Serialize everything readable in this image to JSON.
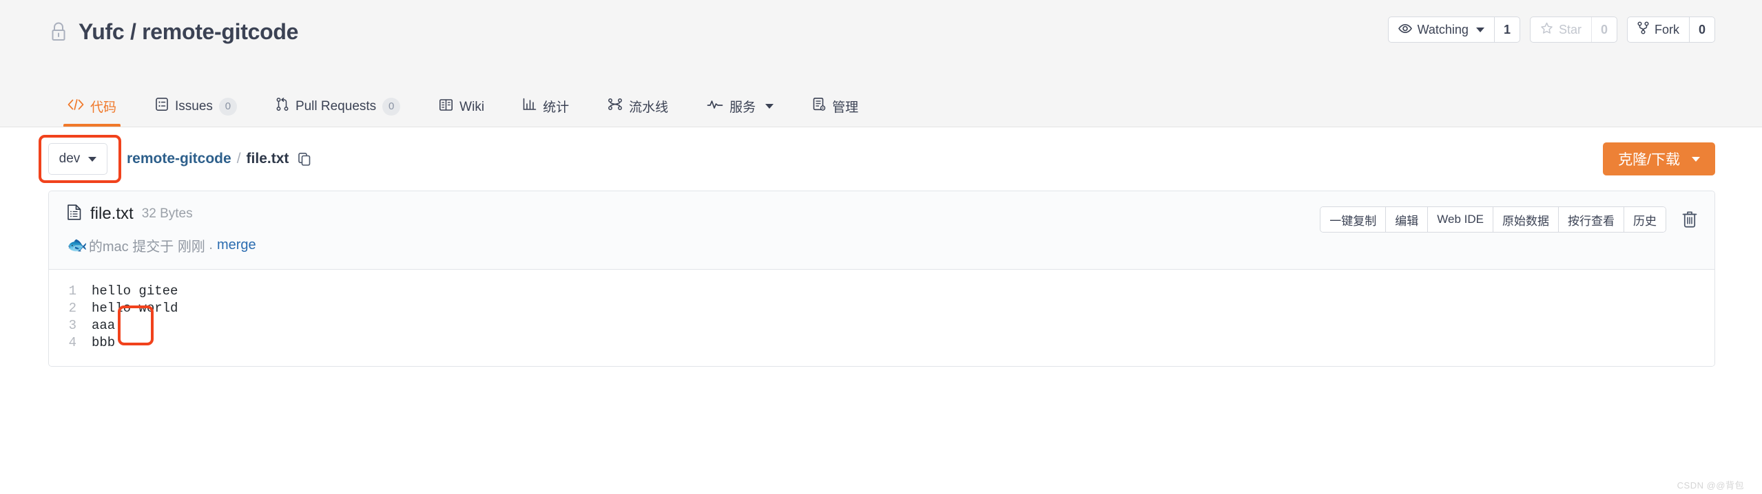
{
  "header": {
    "lock_icon": "lock-icon",
    "title": "Yufc / remote-gitcode",
    "actions": {
      "watch": {
        "icon": "eye-icon",
        "label": "Watching",
        "count": "1"
      },
      "star": {
        "icon": "star-icon",
        "label": "Star",
        "count": "0"
      },
      "fork": {
        "icon": "fork-icon",
        "label": "Fork",
        "count": "0"
      }
    },
    "tabs": [
      {
        "icon": "code-icon",
        "label": "代码",
        "count": null,
        "active": true,
        "has_caret": false
      },
      {
        "icon": "issues-icon",
        "label": "Issues",
        "count": "0",
        "active": false,
        "has_caret": false
      },
      {
        "icon": "pull-request-icon",
        "label": "Pull Requests",
        "count": "0",
        "active": false,
        "has_caret": false
      },
      {
        "icon": "wiki-book-icon",
        "label": "Wiki",
        "count": null,
        "active": false,
        "has_caret": false
      },
      {
        "icon": "stats-chart-icon",
        "label": "统计",
        "count": null,
        "active": false,
        "has_caret": false
      },
      {
        "icon": "pipeline-icon",
        "label": "流水线",
        "count": null,
        "active": false,
        "has_caret": false
      },
      {
        "icon": "service-pulse-icon",
        "label": "服务",
        "count": null,
        "active": false,
        "has_caret": true
      },
      {
        "icon": "manage-doc-icon",
        "label": "管理",
        "count": null,
        "active": false,
        "has_caret": false
      }
    ]
  },
  "toolbar": {
    "branch": {
      "label": "dev",
      "caret_icon": "chevron-down-icon"
    },
    "breadcrumb": {
      "repo": "remote-gitcode",
      "separator": "/",
      "file": "file.txt",
      "copy_icon": "copy-icon"
    },
    "clone_button": {
      "label": "克隆/下载",
      "caret_icon": "chevron-down-icon"
    }
  },
  "file": {
    "icon": "file-text-icon",
    "name": "file.txt",
    "size": "32 Bytes",
    "commit": {
      "avatar_icon": "fish-avatar",
      "author": "的mac",
      "action": "提交于",
      "time": "刚刚",
      "dot": ".",
      "message": "merge"
    },
    "actions": [
      "一键复制",
      "编辑",
      "Web IDE",
      "原始数据",
      "按行查看",
      "历史"
    ],
    "delete_icon": "trash-icon",
    "lines": [
      {
        "num": "1",
        "text": "hello gitee"
      },
      {
        "num": "2",
        "text": "hello world"
      },
      {
        "num": "3",
        "text": "aaa"
      },
      {
        "num": "4",
        "text": "bbb"
      }
    ]
  },
  "annotations": {
    "color": "#f1421c",
    "branch_highlight": "dev",
    "code_highlight": "aaa / bbb"
  },
  "watermark": "CSDN @@背包",
  "colors": {
    "accent_orange": "#f0792b",
    "clone_orange": "#ed8136",
    "link_blue": "#2b6cb0",
    "header_bg": "#f5f5f5",
    "annotation_red": "#f1421c"
  }
}
